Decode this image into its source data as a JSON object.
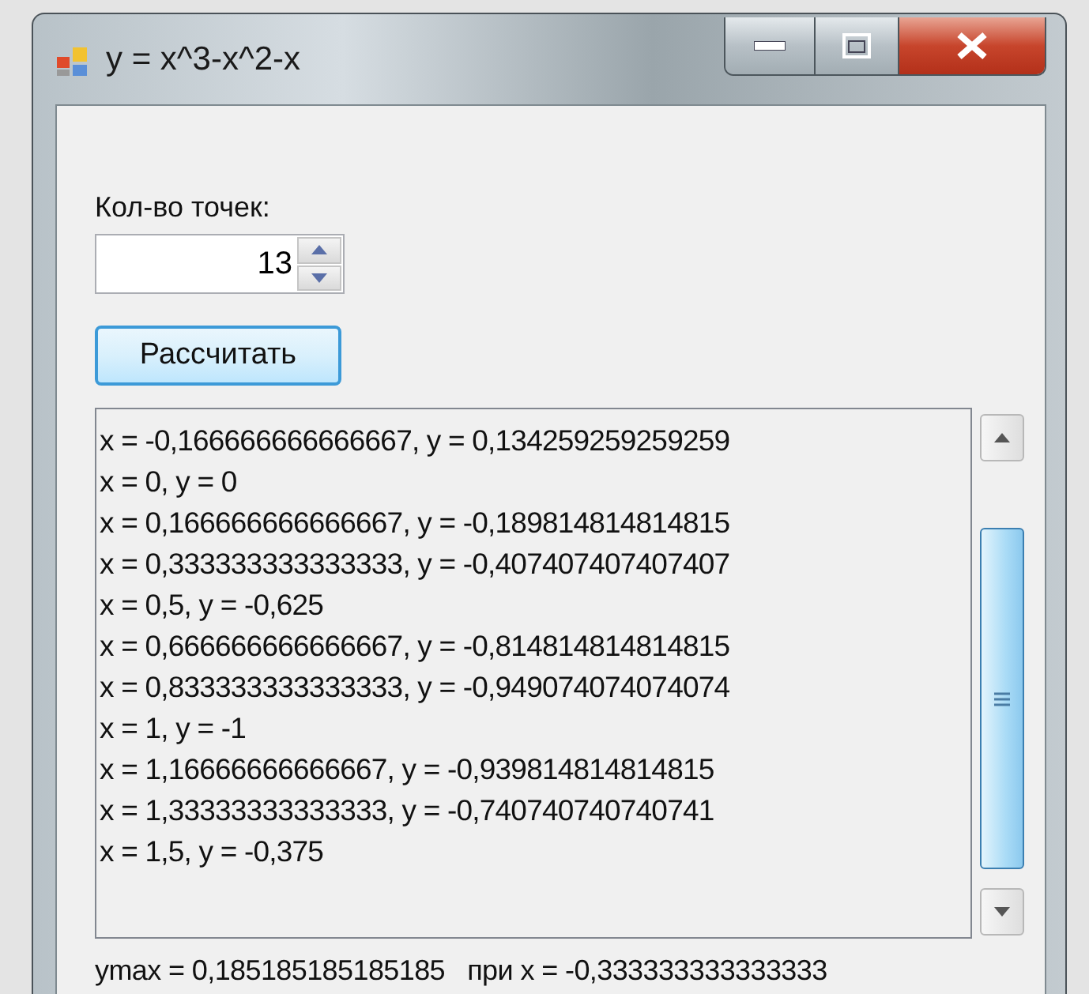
{
  "window": {
    "title": "y = x^3-x^2-x"
  },
  "points_label": "Кол-во точек:",
  "points_field": {
    "value": "13"
  },
  "calculate_button": "Рассчитать",
  "results": [
    "x = -0,166666666666667, y = 0,134259259259259",
    "x = 0, y = 0",
    "x = 0,166666666666667, y = -0,189814814814815",
    "x = 0,333333333333333, y = -0,407407407407407",
    "x = 0,5, y = -0,625",
    "x = 0,666666666666667, y = -0,814814814814815",
    "x = 0,833333333333333, y = -0,949074074074074",
    "x = 1, y = -1",
    "x = 1,16666666666667, y = -0,939814814814815",
    "x = 1,33333333333333, y = -0,740740740740741",
    "x = 1,5, y = -0,375"
  ],
  "summary": "ymax = 0,185185185185185   при x = -0,333333333333333"
}
